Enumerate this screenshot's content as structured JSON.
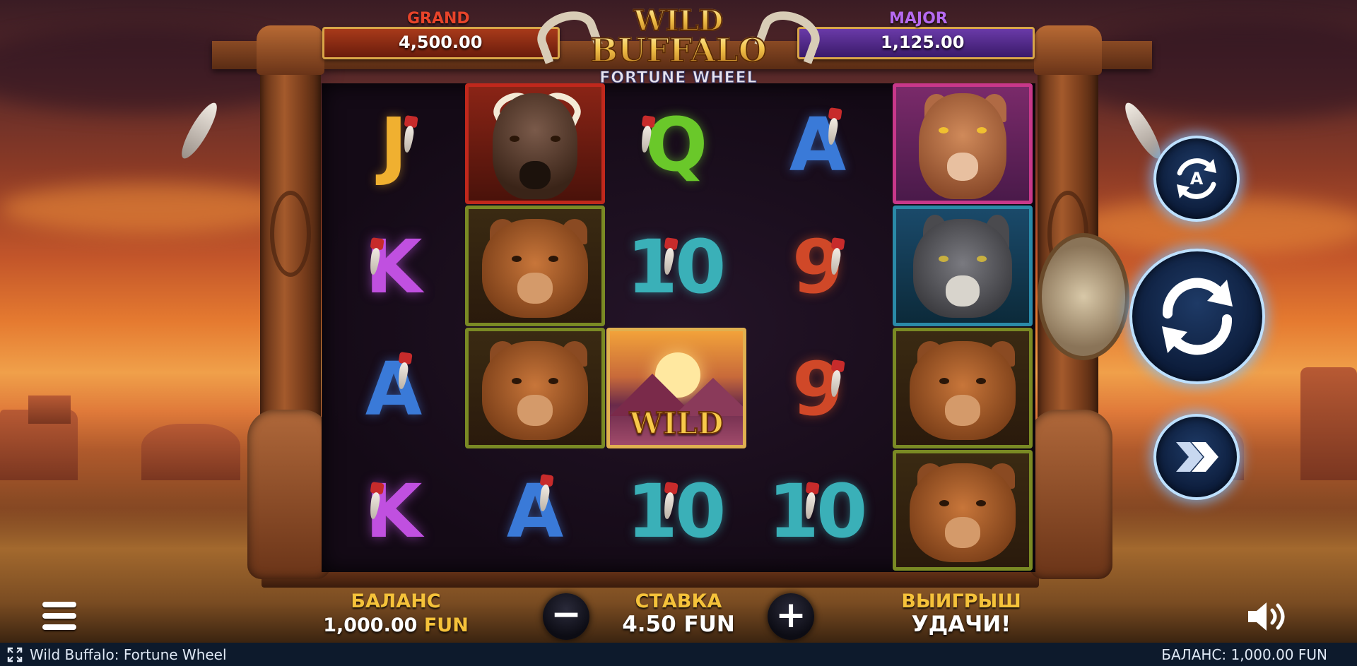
{
  "jackpots": {
    "grand": {
      "label": "GRAND",
      "value": "4,500.00"
    },
    "major": {
      "label": "MAJOR",
      "value": "1,125.00"
    }
  },
  "logo": {
    "line1": "WILD",
    "line2": "BUFFALO",
    "line3": "FORTUNE WHEEL"
  },
  "reels": [
    [
      "J",
      "buffalo",
      "K",
      "bear",
      "A",
      "bear",
      "K",
      "A"
    ],
    [
      "Q",
      "10",
      "wild",
      "10"
    ],
    [
      "A",
      "9",
      "9",
      "10"
    ],
    [
      "cougar",
      "wolf",
      "bear",
      "bear"
    ]
  ],
  "symbol_labels": {
    "j": "J",
    "k": "K",
    "a": "A",
    "q": "Q",
    "ten": "10",
    "nine": "9",
    "wild": "WILD"
  },
  "side_buttons": {
    "autoplay_icon": "autoplay-icon",
    "autoplay_letter": "A",
    "spin_icon": "spin-icon",
    "turbo_icon": "turbo-icon"
  },
  "hud": {
    "balance_label": "БАЛАНС",
    "balance_amount": "1,000.00",
    "balance_currency": "FUN",
    "bet_label": "СТАВКА",
    "bet_amount": "4.50",
    "bet_currency": "FUN",
    "bet_minus": "−",
    "bet_plus": "+",
    "win_label": "ВЫИГРЫШ",
    "win_message": "УДАЧИ!"
  },
  "statusbar": {
    "title": "Wild Buffalo: Fortune Wheel",
    "balance": "БАЛАНС: 1,000.00 FUN"
  },
  "colors": {
    "grand_bar": "#8a2a14",
    "major_bar": "#4a2a7a",
    "j": "#f0b030",
    "k": "#c050e0",
    "a": "#3a7ad8",
    "q": "#6ac82a",
    "ten": "#3ab0b8",
    "nine": "#d04828",
    "card_red": "#c0281c",
    "card_green": "#7a8a24",
    "card_pink": "#c8388a",
    "card_teal": "#2a8aa8",
    "card_gold": "#e0b050"
  }
}
